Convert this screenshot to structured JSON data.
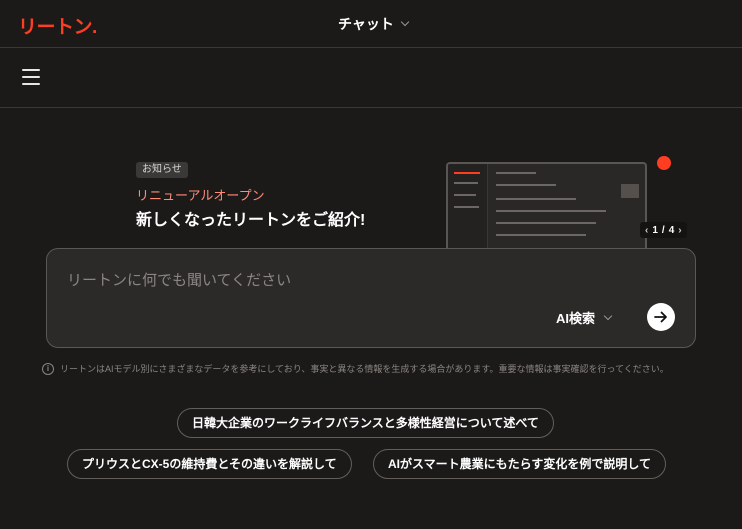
{
  "header": {
    "logo": "リートン.",
    "mode_label": "チャット"
  },
  "banner": {
    "badge": "お知らせ",
    "subtitle": "リニューアルオープン",
    "title": "新しくなったリートンをご紹介!",
    "pager": {
      "current": "1",
      "separator": "/",
      "total": "4"
    }
  },
  "input": {
    "placeholder": "リートンに何でも聞いてください",
    "search_mode": "AI検索"
  },
  "disclaimer": "リートンはAIモデル別にさまざまなデータを参考にしており、事実と異なる情報を生成する場合があります。重要な情報は事実確認を行ってください。",
  "suggestions": [
    "日韓大企業のワークライフバランスと多様性経営について述べて",
    "プリウスとCX-5の維持費とその違いを解説して",
    "AIがスマート農業にもたらす変化を例で説明して"
  ],
  "colors": {
    "brand": "#ff3d21",
    "background": "#1c1a19",
    "accent_text": "#ff8a76"
  },
  "icons": [
    "menu-icon",
    "chevron-down-icon",
    "arrow-right-icon",
    "info-icon",
    "chevron-left-icon",
    "chevron-right-icon"
  ]
}
